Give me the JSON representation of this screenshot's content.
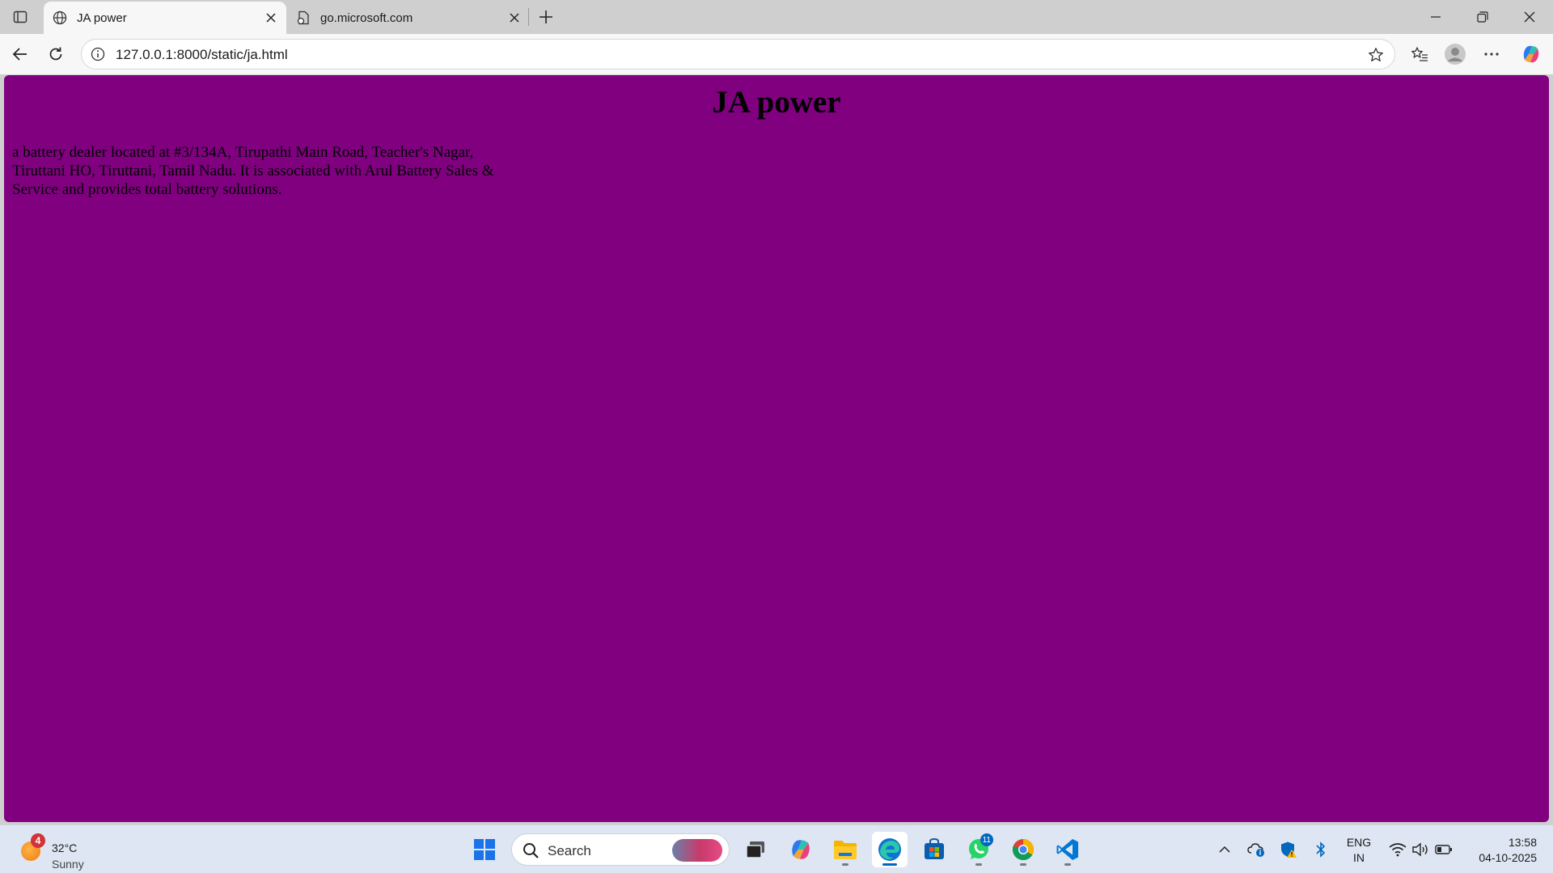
{
  "browser": {
    "tabs": [
      {
        "title": "JA power",
        "active": true,
        "icon": "globe-icon"
      },
      {
        "title": "go.microsoft.com",
        "active": false,
        "icon": "page-loading-icon"
      }
    ],
    "url": "127.0.0.1:8000/static/ja.html"
  },
  "page": {
    "background_color": "#800080",
    "heading": "JA power",
    "description": "a battery dealer located at #3/134A, Tirupathi Main Road, Teacher's Nagar, Tiruttani HO, Tiruttani, Tamil Nadu. It is associated with Arul Battery Sales & Service and provides total battery solutions."
  },
  "taskbar": {
    "weather": {
      "temperature": "32°C",
      "condition": "Sunny",
      "badge": "4"
    },
    "search_placeholder": "Search",
    "pinned": [
      {
        "name": "start-button",
        "icon": "windows-logo-icon"
      },
      {
        "name": "task-view-button",
        "icon": "task-view-icon"
      },
      {
        "name": "copilot-app",
        "icon": "copilot-icon"
      },
      {
        "name": "file-explorer-app",
        "icon": "folder-icon"
      },
      {
        "name": "edge-app",
        "icon": "edge-icon"
      },
      {
        "name": "store-app",
        "icon": "store-icon"
      },
      {
        "name": "whatsapp-app",
        "icon": "whatsapp-icon",
        "badge": "11"
      },
      {
        "name": "chrome-app",
        "icon": "chrome-icon"
      },
      {
        "name": "vscode-app",
        "icon": "vscode-icon"
      }
    ],
    "language": {
      "line1": "ENG",
      "line2": "IN"
    },
    "clock": {
      "time": "13:58",
      "date": "04-10-2025"
    }
  }
}
